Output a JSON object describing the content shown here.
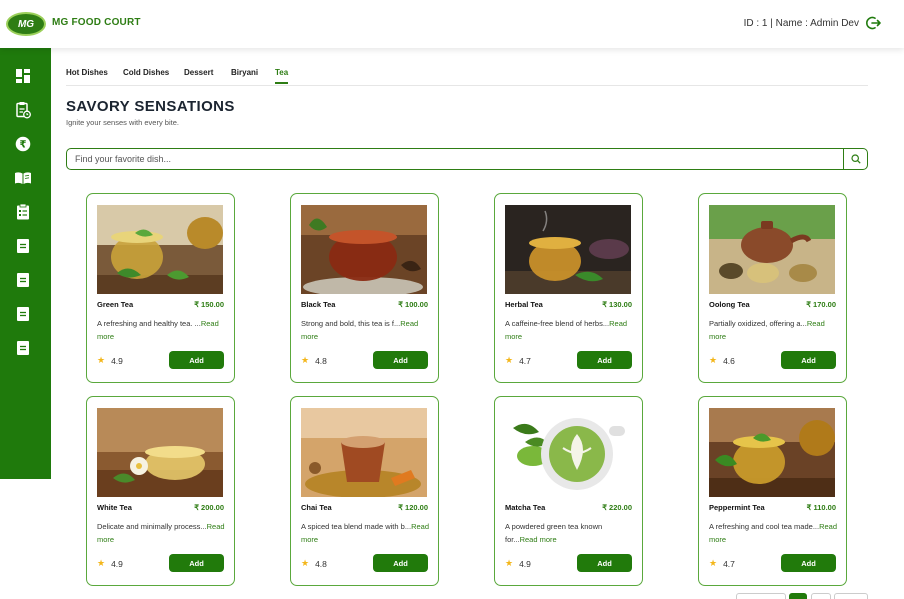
{
  "header": {
    "logo_text": "MG",
    "brand": "MG FOOD COURT",
    "user_info": "ID : 1 | Name : Admin Dev"
  },
  "sidebar": {
    "items": [
      {
        "icon": "dashboard-icon"
      },
      {
        "icon": "clipboard-clock-icon"
      },
      {
        "icon": "rupee-icon"
      },
      {
        "icon": "book-icon"
      },
      {
        "icon": "checklist-icon"
      },
      {
        "icon": "document-icon"
      },
      {
        "icon": "document-icon"
      },
      {
        "icon": "document-icon"
      },
      {
        "icon": "document-icon"
      }
    ]
  },
  "tabs": [
    "Hot Dishes",
    "Cold Dishes",
    "Dessert",
    "Biryani",
    "Tea"
  ],
  "active_tab": "Tea",
  "page": {
    "title": "SAVORY SENSATIONS",
    "subtitle": "Ignite your senses with every bite."
  },
  "search": {
    "placeholder": "Find your favorite dish..."
  },
  "add_label": "Add",
  "read_more": "Read more",
  "products": [
    {
      "name": "Green Tea",
      "price": "₹ 150.00",
      "desc": "A refreshing and healthy tea. ...",
      "rating": "4.9"
    },
    {
      "name": "Black Tea",
      "price": "₹ 100.00",
      "desc": "Strong and bold, this tea is f...",
      "rating": "4.8"
    },
    {
      "name": "Herbal Tea",
      "price": "₹ 130.00",
      "desc": "A caffeine-free blend of herbs...",
      "rating": "4.7"
    },
    {
      "name": "Oolong Tea",
      "price": "₹ 170.00",
      "desc": "Partially oxidized, offering a...",
      "rating": "4.6"
    },
    {
      "name": "White Tea",
      "price": "₹ 200.00",
      "desc": "Delicate and minimally process...",
      "rating": "4.9"
    },
    {
      "name": "Chai Tea",
      "price": "₹ 120.00",
      "desc": "A spiced tea blend made with b...",
      "rating": "4.8"
    },
    {
      "name": "Matcha Tea",
      "price": "₹ 220.00",
      "desc": "A powdered green tea known for...",
      "rating": "4.9"
    },
    {
      "name": "Peppermint Tea",
      "price": "₹ 110.00",
      "desc": "A refreshing and cool tea made...",
      "rating": "4.7"
    }
  ],
  "colors": {
    "primary": "#217a0b",
    "accent": "#2e7d14",
    "star": "#f3b61a",
    "card_border": "#5aa83c"
  }
}
